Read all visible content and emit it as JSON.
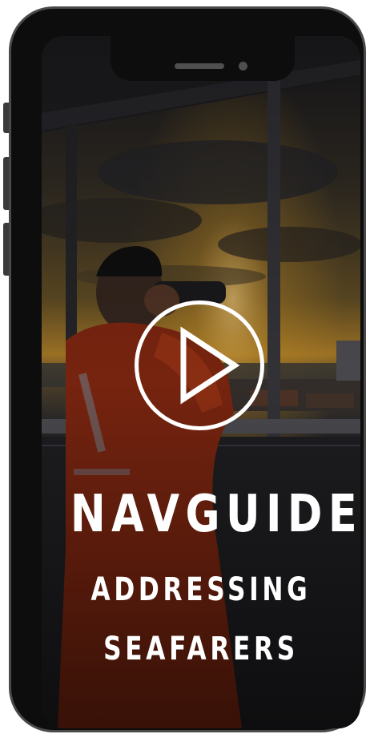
{
  "video": {
    "title": "NAVGUIDE",
    "subtitle_line1": "ADDRESSING",
    "subtitle_line2": "SEAFARERS",
    "play_icon": "play-icon",
    "colors": {
      "text": "#ffffff",
      "sky_glow": "#e0a22a",
      "jacket": "#8b2a12"
    }
  }
}
